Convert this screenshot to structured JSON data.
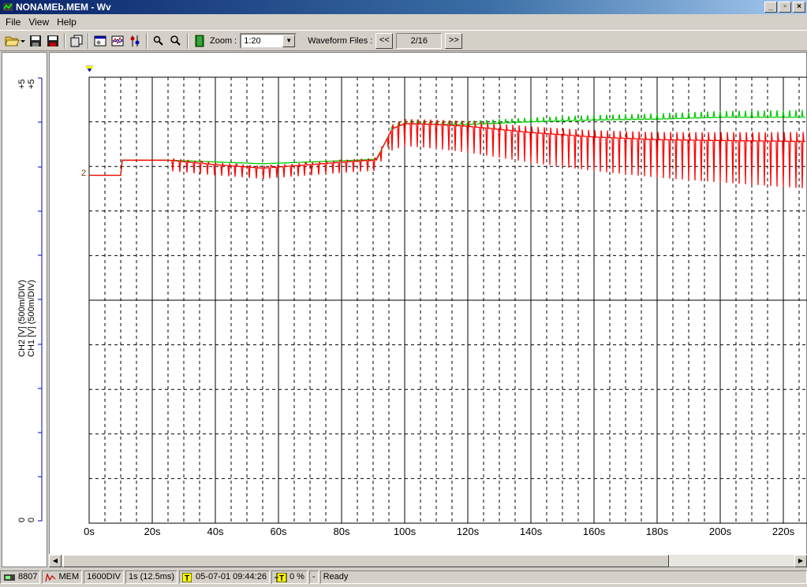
{
  "window": {
    "title": "NONAMEb.MEM - Wv",
    "buttons": {
      "minimize": "_",
      "maximize": "▫",
      "close": "×"
    }
  },
  "menu": [
    "File",
    "View",
    "Help"
  ],
  "toolbar": {
    "zoom_label": "Zoom :",
    "zoom_value": "1:20",
    "waveform_label": "Waveform Files :",
    "prev_label": "<<",
    "next_label": ">>",
    "file_index": "2/16"
  },
  "left_axis": {
    "ch2_label": "CH2  [V]  (500m/DIV)",
    "ch1_label": "CH1  [V]  (500m/DIV)",
    "top_value_ch2": "+5",
    "top_value_ch1": "+5",
    "bottom_value_ch2": "0",
    "bottom_value_ch1": "0"
  },
  "chart_data": {
    "type": "line",
    "x_unit": "s",
    "xlim": [
      0,
      227
    ],
    "x_ticks": [
      "0s",
      "20s",
      "40s",
      "60s",
      "80s",
      "100s",
      "120s",
      "140s",
      "160s",
      "180s",
      "200s",
      "220s"
    ],
    "ylim": [
      0,
      5
    ],
    "y_divisions": 10,
    "ch_marker": "2",
    "colors": {
      "ch1": "#ff0000",
      "ch2": "#00cc00",
      "grid": "#000000"
    },
    "series": [
      {
        "name": "CH1",
        "baseline_x": [
          0,
          10,
          10.5,
          25,
          40,
          55,
          70,
          85,
          91,
          96,
          100,
          110,
          120,
          140,
          160,
          180,
          200,
          227
        ],
        "baseline_y": [
          3.9,
          3.9,
          4.07,
          4.07,
          4.02,
          3.98,
          4.02,
          4.06,
          4.07,
          4.42,
          4.48,
          4.47,
          4.45,
          4.38,
          4.33,
          4.3,
          4.29,
          4.28
        ],
        "ripple_start": 25,
        "ripple_depth": 0.12
      },
      {
        "name": "CH2",
        "baseline_x": [
          0,
          10,
          10.5,
          25,
          40,
          55,
          70,
          85,
          91,
          96,
          100,
          110,
          120,
          140,
          160,
          180,
          200,
          227
        ],
        "baseline_y": [
          3.9,
          3.9,
          4.07,
          4.07,
          4.05,
          4.03,
          4.05,
          4.07,
          4.08,
          4.42,
          4.48,
          4.47,
          4.47,
          4.5,
          4.52,
          4.53,
          4.55,
          4.55
        ]
      }
    ]
  },
  "status": {
    "device": "8807",
    "mode": "MEM",
    "length": "1600DIV",
    "rate": "1s (12.5ms)",
    "trigger_time": "05-07-01 09:44:26",
    "pretrigger": "0 %",
    "dash": "-",
    "state": "Ready"
  }
}
